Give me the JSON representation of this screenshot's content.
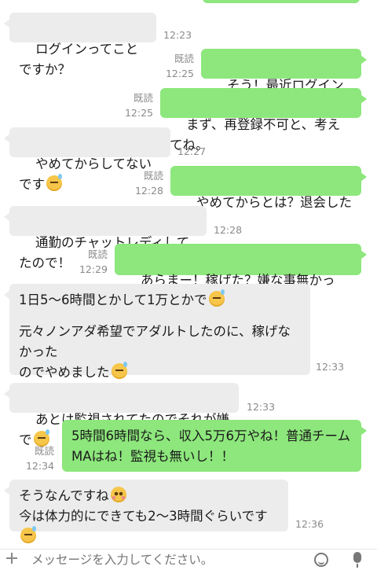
{
  "messages": [
    {
      "side": "in",
      "text": "ログインってことですか？",
      "time": "12:23"
    },
    {
      "side": "out",
      "text": "そう！最近ログインした？",
      "read": "既読",
      "time": "12:25"
    },
    {
      "side": "out",
      "text": "まず、再登録不可と、考えてね。",
      "read": "既読",
      "time": "12:25"
    },
    {
      "side": "in",
      "text": "やめてからしてないです",
      "emoji": "sweat-smile",
      "time": "12:27"
    },
    {
      "side": "out",
      "text": "やめてからとは？退会したの？",
      "read": "既読",
      "time": "12:28"
    },
    {
      "side": "in",
      "text": "通勤のチャットレディしてたので！",
      "time": "12:28"
    },
    {
      "side": "out",
      "text": "あらまー！稼げた？嫌な事無かった？？",
      "read": "既読",
      "time": "12:29"
    },
    {
      "side": "in",
      "line1": "1日5〜6時間とかして1万とかで",
      "line2": "元々ノンアダ希望でアダルトしたのに、稼げなかった",
      "line3": "のでやめました",
      "time": "12:33"
    },
    {
      "side": "in",
      "text": "あとは監視されてたのでそれが嫌で",
      "time": "12:33"
    },
    {
      "side": "out",
      "line1": "5時間6時間なら、収入5万6万やね！普通チーム",
      "line2": "MAはね！監視も無いし！！",
      "read": "既読",
      "time": "12:34"
    },
    {
      "side": "in",
      "line1": "そうなんですね",
      "line2": "今は体力的にできても2〜3時間ぐらいです",
      "time": "12:36"
    }
  ],
  "composer": {
    "placeholder": "メッセージを入力してください。"
  },
  "icons": {
    "attach": "plus-icon",
    "sticker": "smile-icon",
    "voice": "mic-icon"
  },
  "colors": {
    "incoming": "#ececec",
    "outgoing": "#8de77c",
    "meta": "#8a8a8a"
  }
}
